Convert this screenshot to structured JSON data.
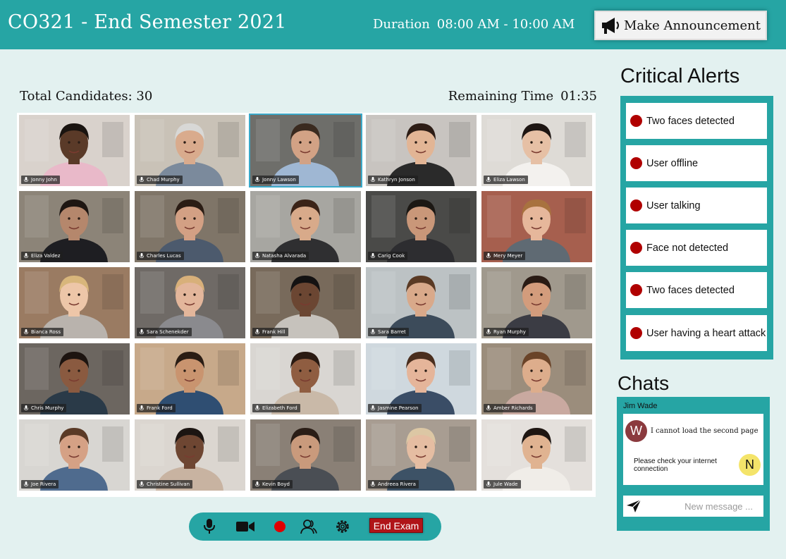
{
  "header": {
    "title": "CO321 - End Semester 2021",
    "duration_label": "Duration",
    "duration_value": "08:00 AM - 10:00 AM",
    "announce_label": "Make Announcement",
    "announce_icon": "megaphone-icon"
  },
  "stats": {
    "total_label": "Total Candidates: 30",
    "remaining_label": "Remaining Time",
    "remaining_value": "01:35"
  },
  "candidates": [
    {
      "name": "Jonny John",
      "skin": "#5a3a28",
      "hair": "#1a1410",
      "bg": "#d9d2cc",
      "shirt": "#e9b9c9"
    },
    {
      "name": "Chad Murphy",
      "skin": "#d9ab8d",
      "hair": "#d8d8d6",
      "bg": "#c9c2b7",
      "shirt": "#7b8a9c"
    },
    {
      "name": "Jonny Lawson",
      "skin": "#d2a285",
      "hair": "#3a2a1f",
      "bg": "#6e6e6a",
      "shirt": "#9fb7d3",
      "active": true
    },
    {
      "name": "Kathryn Jonson",
      "skin": "#e2b595",
      "hair": "#2d1d16",
      "bg": "#c8c4c0",
      "shirt": "#2a2a2a"
    },
    {
      "name": "Eliza Lawson",
      "skin": "#e6c0a5",
      "hair": "#1d1512",
      "bg": "#dedbd6",
      "shirt": "#f3f1ee"
    },
    {
      "name": "Eliza Valdez",
      "skin": "#b5876c",
      "hair": "#1e1612",
      "bg": "#8c8478",
      "shirt": "#1e1e22"
    },
    {
      "name": "Charles Lucas",
      "skin": "#d3a084",
      "hair": "#2a1c14",
      "bg": "#7f7568",
      "shirt": "#4c5a6d"
    },
    {
      "name": "Natasha Alvarada",
      "skin": "#d8aa8a",
      "hair": "#3b2418",
      "bg": "#a7a6a1",
      "shirt": "#2f2f31"
    },
    {
      "name": "Carig Cook",
      "skin": "#c99779",
      "hair": "#1c1814",
      "bg": "#4a4a48",
      "shirt": "#2d2d30"
    },
    {
      "name": "Mery Meyer",
      "skin": "#e6b79b",
      "hair": "#a8723f",
      "bg": "#a65f4e",
      "shirt": "#5f6a73"
    },
    {
      "name": "Bianca Ross",
      "skin": "#edc6a8",
      "hair": "#d8b67b",
      "bg": "#9a7b62",
      "shirt": "#b9b3ad"
    },
    {
      "name": "Sara Schenekder",
      "skin": "#e3b69b",
      "hair": "#d8b07a",
      "bg": "#6f6a66",
      "shirt": "#8a8a8e"
    },
    {
      "name": "Frank Hill",
      "skin": "#6b4632",
      "hair": "#141212",
      "bg": "#786a5b",
      "shirt": "#c6c2bc"
    },
    {
      "name": "Sara Barret",
      "skin": "#d9a98a",
      "hair": "#5a3a24",
      "bg": "#bcc2c4",
      "shirt": "#3c4b5a"
    },
    {
      "name": "Ryan Murphy",
      "skin": "#d39c7c",
      "hair": "#2a1b14",
      "bg": "#a0998d",
      "shirt": "#3b3c44"
    },
    {
      "name": "Chris Murphy",
      "skin": "#8a5a40",
      "hair": "#1d1410",
      "bg": "#6c6660",
      "shirt": "#2a3a48"
    },
    {
      "name": "Frank Ford",
      "skin": "#c9946f",
      "hair": "#2a1d14",
      "bg": "#c7a98a",
      "shirt": "#2f4e72"
    },
    {
      "name": "Elizabeth Ford",
      "skin": "#8f5d41",
      "hair": "#2a1a12",
      "bg": "#d9d6d2",
      "shirt": "#c9b9a8"
    },
    {
      "name": "Jasmine Pearson",
      "skin": "#e5b59a",
      "hair": "#4a2e1e",
      "bg": "#cfd8de",
      "shirt": "#3a4d66"
    },
    {
      "name": "Amber Richards",
      "skin": "#ddad8c",
      "hair": "#6a4328",
      "bg": "#9b8d7c",
      "shirt": "#c9a9a0"
    },
    {
      "name": "Joe Rivera",
      "skin": "#d5a185",
      "hair": "#5a3a26",
      "bg": "#d8d6d2",
      "shirt": "#4f6b8e"
    },
    {
      "name": "Christine Sullivan",
      "skin": "#6e4632",
      "hair": "#1c1512",
      "bg": "#dbd6d0",
      "shirt": "#c8b3a1"
    },
    {
      "name": "Kevin Boyd",
      "skin": "#c99a7c",
      "hair": "#2a1d16",
      "bg": "#8a8076",
      "shirt": "#4a4e54"
    },
    {
      "name": "Andreea Rivera",
      "skin": "#e5bda2",
      "hair": "#dcc7a4",
      "bg": "#a89d92",
      "shirt": "#3d5266"
    },
    {
      "name": "Jule Wade",
      "skin": "#e0b391",
      "hair": "#1e1612",
      "bg": "#e4e0dc",
      "shirt": "#f0ede8"
    }
  ],
  "controls": {
    "icons": [
      "microphone-icon",
      "camera-icon",
      "record-icon",
      "participants-icon",
      "settings-icon"
    ],
    "end_label": "End Exam"
  },
  "alerts": {
    "title": "Critical Alerts",
    "items": [
      "Two faces detected",
      "User offline",
      "User talking",
      "Face not detected",
      "Two faces detected",
      "User having a heart attack"
    ]
  },
  "chats": {
    "title": "Chats",
    "user": "Jim Wade",
    "incoming_avatar": "W",
    "incoming": "I cannot load the second page",
    "outgoing": "Please check your internet connection",
    "outgoing_avatar": "N",
    "placeholder": "New message ..."
  },
  "colors": {
    "teal": "#26a5a4",
    "background": "#e3f1f0",
    "alert_dot": "#b00000",
    "end_button": "#b01418"
  }
}
